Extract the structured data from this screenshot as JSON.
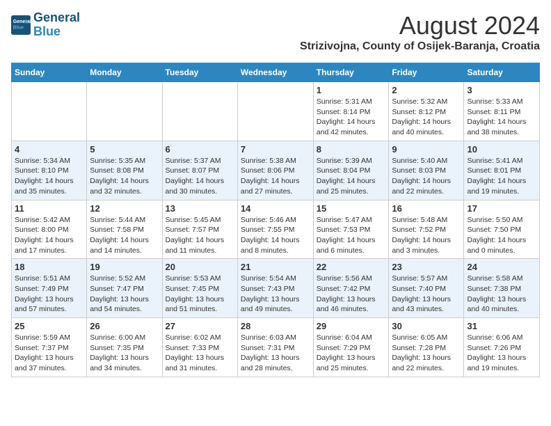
{
  "logo": {
    "line1": "General",
    "line2": "Blue"
  },
  "title": "August 2024",
  "subtitle": "Strizivojna, County of Osijek-Baranja, Croatia",
  "weekdays": [
    "Sunday",
    "Monday",
    "Tuesday",
    "Wednesday",
    "Thursday",
    "Friday",
    "Saturday"
  ],
  "weeks": [
    [
      {
        "day": "",
        "info": ""
      },
      {
        "day": "",
        "info": ""
      },
      {
        "day": "",
        "info": ""
      },
      {
        "day": "",
        "info": ""
      },
      {
        "day": "1",
        "info": "Sunrise: 5:31 AM\nSunset: 8:14 PM\nDaylight: 14 hours\nand 42 minutes."
      },
      {
        "day": "2",
        "info": "Sunrise: 5:32 AM\nSunset: 8:12 PM\nDaylight: 14 hours\nand 40 minutes."
      },
      {
        "day": "3",
        "info": "Sunrise: 5:33 AM\nSunset: 8:11 PM\nDaylight: 14 hours\nand 38 minutes."
      }
    ],
    [
      {
        "day": "4",
        "info": "Sunrise: 5:34 AM\nSunset: 8:10 PM\nDaylight: 14 hours\nand 35 minutes."
      },
      {
        "day": "5",
        "info": "Sunrise: 5:35 AM\nSunset: 8:08 PM\nDaylight: 14 hours\nand 32 minutes."
      },
      {
        "day": "6",
        "info": "Sunrise: 5:37 AM\nSunset: 8:07 PM\nDaylight: 14 hours\nand 30 minutes."
      },
      {
        "day": "7",
        "info": "Sunrise: 5:38 AM\nSunset: 8:06 PM\nDaylight: 14 hours\nand 27 minutes."
      },
      {
        "day": "8",
        "info": "Sunrise: 5:39 AM\nSunset: 8:04 PM\nDaylight: 14 hours\nand 25 minutes."
      },
      {
        "day": "9",
        "info": "Sunrise: 5:40 AM\nSunset: 8:03 PM\nDaylight: 14 hours\nand 22 minutes."
      },
      {
        "day": "10",
        "info": "Sunrise: 5:41 AM\nSunset: 8:01 PM\nDaylight: 14 hours\nand 19 minutes."
      }
    ],
    [
      {
        "day": "11",
        "info": "Sunrise: 5:42 AM\nSunset: 8:00 PM\nDaylight: 14 hours\nand 17 minutes."
      },
      {
        "day": "12",
        "info": "Sunrise: 5:44 AM\nSunset: 7:58 PM\nDaylight: 14 hours\nand 14 minutes."
      },
      {
        "day": "13",
        "info": "Sunrise: 5:45 AM\nSunset: 7:57 PM\nDaylight: 14 hours\nand 11 minutes."
      },
      {
        "day": "14",
        "info": "Sunrise: 5:46 AM\nSunset: 7:55 PM\nDaylight: 14 hours\nand 8 minutes."
      },
      {
        "day": "15",
        "info": "Sunrise: 5:47 AM\nSunset: 7:53 PM\nDaylight: 14 hours\nand 6 minutes."
      },
      {
        "day": "16",
        "info": "Sunrise: 5:48 AM\nSunset: 7:52 PM\nDaylight: 14 hours\nand 3 minutes."
      },
      {
        "day": "17",
        "info": "Sunrise: 5:50 AM\nSunset: 7:50 PM\nDaylight: 14 hours\nand 0 minutes."
      }
    ],
    [
      {
        "day": "18",
        "info": "Sunrise: 5:51 AM\nSunset: 7:49 PM\nDaylight: 13 hours\nand 57 minutes."
      },
      {
        "day": "19",
        "info": "Sunrise: 5:52 AM\nSunset: 7:47 PM\nDaylight: 13 hours\nand 54 minutes."
      },
      {
        "day": "20",
        "info": "Sunrise: 5:53 AM\nSunset: 7:45 PM\nDaylight: 13 hours\nand 51 minutes."
      },
      {
        "day": "21",
        "info": "Sunrise: 5:54 AM\nSunset: 7:43 PM\nDaylight: 13 hours\nand 49 minutes."
      },
      {
        "day": "22",
        "info": "Sunrise: 5:56 AM\nSunset: 7:42 PM\nDaylight: 13 hours\nand 46 minutes."
      },
      {
        "day": "23",
        "info": "Sunrise: 5:57 AM\nSunset: 7:40 PM\nDaylight: 13 hours\nand 43 minutes."
      },
      {
        "day": "24",
        "info": "Sunrise: 5:58 AM\nSunset: 7:38 PM\nDaylight: 13 hours\nand 40 minutes."
      }
    ],
    [
      {
        "day": "25",
        "info": "Sunrise: 5:59 AM\nSunset: 7:37 PM\nDaylight: 13 hours\nand 37 minutes."
      },
      {
        "day": "26",
        "info": "Sunrise: 6:00 AM\nSunset: 7:35 PM\nDaylight: 13 hours\nand 34 minutes."
      },
      {
        "day": "27",
        "info": "Sunrise: 6:02 AM\nSunset: 7:33 PM\nDaylight: 13 hours\nand 31 minutes."
      },
      {
        "day": "28",
        "info": "Sunrise: 6:03 AM\nSunset: 7:31 PM\nDaylight: 13 hours\nand 28 minutes."
      },
      {
        "day": "29",
        "info": "Sunrise: 6:04 AM\nSunset: 7:29 PM\nDaylight: 13 hours\nand 25 minutes."
      },
      {
        "day": "30",
        "info": "Sunrise: 6:05 AM\nSunset: 7:28 PM\nDaylight: 13 hours\nand 22 minutes."
      },
      {
        "day": "31",
        "info": "Sunrise: 6:06 AM\nSunset: 7:26 PM\nDaylight: 13 hours\nand 19 minutes."
      }
    ]
  ]
}
